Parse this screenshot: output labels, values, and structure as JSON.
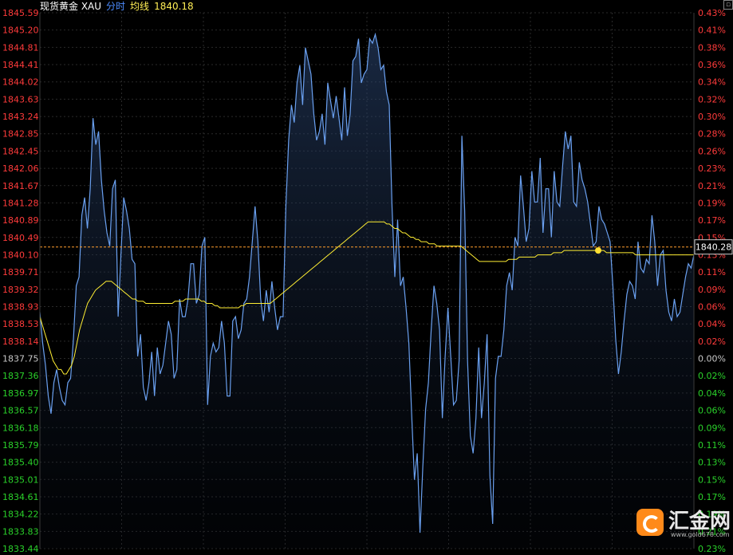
{
  "header": {
    "instrument": "现货黄金 XAU",
    "tab": "分时",
    "avg_label": "均线",
    "price": "1840.18"
  },
  "colors": {
    "up": "#ff3b3b",
    "down": "#2ad12a",
    "neutral": "#c8c8c8",
    "price_line": "#6aa0f0",
    "avg_line": "#ffee33",
    "ref_line": "#ff9d2e"
  },
  "watermark": {
    "text": "汇金网",
    "url": "www.gold678.com"
  },
  "chart_data": {
    "type": "line",
    "ylim": [
      1833.44,
      1845.59
    ],
    "reference_price": 1837.75,
    "last_price_label": "1840.28",
    "last_price": 1840.28,
    "price_ticks": [
      "1845.59",
      "1845.20",
      "1844.81",
      "1844.41",
      "1844.02",
      "1843.63",
      "1843.24",
      "1842.85",
      "1842.45",
      "1842.06",
      "1841.67",
      "1841.28",
      "1840.89",
      "1840.49",
      "1840.10",
      "1839.71",
      "1839.32",
      "1838.93",
      "1838.53",
      "1838.14",
      "1837.75",
      "1837.36",
      "1836.97",
      "1836.57",
      "1836.18",
      "1835.79",
      "1835.40",
      "1835.01",
      "1834.61",
      "1834.22",
      "1833.83",
      "1833.44"
    ],
    "pct_ticks": [
      "0.43%",
      "0.41%",
      "0.38%",
      "0.36%",
      "0.34%",
      "0.32%",
      "0.30%",
      "0.28%",
      "0.26%",
      "0.23%",
      "0.21%",
      "0.19%",
      "0.17%",
      "0.15%",
      "0.13%",
      "0.11%",
      "0.09%",
      "0.06%",
      "0.04%",
      "0.02%",
      "0.00%",
      "0.02%",
      "0.04%",
      "0.06%",
      "0.09%",
      "0.11%",
      "0.13%",
      "0.15%",
      "0.17%",
      "0.19%",
      "0.21%",
      "0.23%"
    ],
    "series": [
      {
        "values": [
          1838.8,
          1838.1,
          1837.6,
          1836.9,
          1836.5,
          1837.2,
          1837.5,
          1837.1,
          1836.8,
          1836.7,
          1837.2,
          1837.3,
          1838.2,
          1839.4,
          1839.6,
          1841.0,
          1841.4,
          1840.7,
          1841.6,
          1843.2,
          1842.6,
          1842.9,
          1841.8,
          1841.1,
          1840.6,
          1840.3,
          1841.6,
          1841.8,
          1838.7,
          1840.1,
          1841.4,
          1841.1,
          1840.7,
          1840.0,
          1839.9,
          1837.8,
          1838.3,
          1837.1,
          1836.8,
          1837.2,
          1837.9,
          1836.9,
          1838.0,
          1837.4,
          1837.6,
          1838.1,
          1838.6,
          1838.3,
          1837.3,
          1837.5,
          1839.1,
          1838.7,
          1838.7,
          1839.1,
          1839.9,
          1839.9,
          1839.0,
          1839.2,
          1840.3,
          1840.5,
          1836.7,
          1837.8,
          1838.1,
          1837.9,
          1838.0,
          1838.6,
          1838.1,
          1836.9,
          1836.9,
          1838.6,
          1838.7,
          1838.2,
          1838.4,
          1839.0,
          1839.1,
          1839.6,
          1840.4,
          1841.2,
          1840.4,
          1839.1,
          1838.6,
          1839.3,
          1838.8,
          1839.5,
          1838.9,
          1838.4,
          1838.7,
          1838.7,
          1841.2,
          1842.7,
          1843.5,
          1843.1,
          1844.0,
          1844.4,
          1843.5,
          1844.8,
          1844.5,
          1844.2,
          1843.3,
          1842.7,
          1842.9,
          1843.3,
          1842.6,
          1844.0,
          1843.6,
          1843.2,
          1843.7,
          1843.2,
          1842.7,
          1843.9,
          1842.8,
          1843.3,
          1844.5,
          1844.6,
          1845.0,
          1844.0,
          1844.2,
          1844.3,
          1845.0,
          1844.9,
          1845.1,
          1844.8,
          1844.3,
          1844.4,
          1843.8,
          1843.5,
          1841.2,
          1839.6,
          1840.9,
          1839.4,
          1839.6,
          1838.9,
          1838.1,
          1836.5,
          1835.0,
          1835.6,
          1833.8,
          1835.3,
          1836.6,
          1837.2,
          1838.4,
          1839.4,
          1839.0,
          1838.4,
          1836.4,
          1837.8,
          1838.9,
          1837.8,
          1836.7,
          1836.8,
          1837.7,
          1842.8,
          1841.1,
          1837.7,
          1836.0,
          1835.6,
          1836.4,
          1838.0,
          1836.4,
          1837.2,
          1838.3,
          1835.1,
          1834.0,
          1837.3,
          1837.8,
          1837.8,
          1838.4,
          1839.4,
          1839.7,
          1839.3,
          1840.5,
          1840.3,
          1841.9,
          1841.2,
          1840.4,
          1840.7,
          1842.0,
          1841.3,
          1841.3,
          1842.3,
          1840.6,
          1841.6,
          1841.6,
          1840.5,
          1842.0,
          1841.3,
          1841.2,
          1842.1,
          1842.9,
          1842.5,
          1842.8,
          1841.3,
          1841.2,
          1842.2,
          1841.8,
          1841.6,
          1841.3,
          1840.8,
          1840.3,
          1840.4,
          1841.2,
          1840.9,
          1840.8,
          1840.6,
          1840.4,
          1839.4,
          1838.2,
          1837.4,
          1837.9,
          1838.6,
          1839.2,
          1839.5,
          1839.4,
          1839.1,
          1840.4,
          1839.8,
          1839.7,
          1840.0,
          1839.9,
          1841.0,
          1840.4,
          1839.4,
          1840.1,
          1840.2,
          1839.3,
          1838.8,
          1838.6,
          1839.1,
          1838.7,
          1838.8,
          1839.2,
          1839.6,
          1839.9,
          1839.8,
          1840.1
        ]
      },
      {
        "values": [
          1838.7,
          1838.5,
          1838.3,
          1838.1,
          1837.9,
          1837.7,
          1837.6,
          1837.5,
          1837.5,
          1837.4,
          1837.4,
          1837.5,
          1837.6,
          1837.8,
          1838.1,
          1838.4,
          1838.6,
          1838.8,
          1839.0,
          1839.1,
          1839.2,
          1839.3,
          1839.35,
          1839.4,
          1839.45,
          1839.5,
          1839.5,
          1839.5,
          1839.45,
          1839.4,
          1839.35,
          1839.3,
          1839.25,
          1839.2,
          1839.15,
          1839.1,
          1839.1,
          1839.05,
          1839.05,
          1839.05,
          1839.0,
          1839.0,
          1839.0,
          1839.0,
          1839.0,
          1839.0,
          1839.0,
          1839.0,
          1839.0,
          1839.0,
          1839.0,
          1839.05,
          1839.05,
          1839.05,
          1839.05,
          1839.1,
          1839.1,
          1839.1,
          1839.1,
          1839.1,
          1839.1,
          1839.05,
          1839.05,
          1839.0,
          1839.0,
          1839.0,
          1838.95,
          1838.95,
          1838.9,
          1838.9,
          1838.9,
          1838.9,
          1838.9,
          1838.9,
          1838.9,
          1838.9,
          1838.95,
          1838.95,
          1839.0,
          1839.0,
          1839.0,
          1839.0,
          1839.0,
          1839.0,
          1839.0,
          1839.0,
          1839.0,
          1839.0,
          1839.05,
          1839.1,
          1839.15,
          1839.2,
          1839.25,
          1839.3,
          1839.35,
          1839.4,
          1839.45,
          1839.5,
          1839.55,
          1839.6,
          1839.65,
          1839.7,
          1839.75,
          1839.8,
          1839.85,
          1839.9,
          1839.95,
          1840.0,
          1840.05,
          1840.1,
          1840.15,
          1840.2,
          1840.25,
          1840.3,
          1840.35,
          1840.4,
          1840.45,
          1840.5,
          1840.55,
          1840.6,
          1840.65,
          1840.7,
          1840.75,
          1840.8,
          1840.85,
          1840.85,
          1840.85,
          1840.85,
          1840.85,
          1840.85,
          1840.85,
          1840.8,
          1840.8,
          1840.75,
          1840.7,
          1840.7,
          1840.65,
          1840.6,
          1840.6,
          1840.55,
          1840.5,
          1840.5,
          1840.45,
          1840.45,
          1840.4,
          1840.4,
          1840.4,
          1840.35,
          1840.35,
          1840.35,
          1840.3,
          1840.3,
          1840.3,
          1840.3,
          1840.3,
          1840.3,
          1840.3,
          1840.3,
          1840.3,
          1840.3,
          1840.25,
          1840.2,
          1840.15,
          1840.1,
          1840.05,
          1840.0,
          1839.95,
          1839.95,
          1839.95,
          1839.95,
          1839.95,
          1839.95,
          1839.95,
          1839.95,
          1839.95,
          1839.95,
          1839.95,
          1840.0,
          1840.0,
          1840.0,
          1840.0,
          1840.05,
          1840.05,
          1840.05,
          1840.05,
          1840.05,
          1840.05,
          1840.05,
          1840.1,
          1840.1,
          1840.1,
          1840.1,
          1840.1,
          1840.1,
          1840.15,
          1840.15,
          1840.15,
          1840.15,
          1840.2,
          1840.2,
          1840.2,
          1840.2,
          1840.2,
          1840.2,
          1840.2,
          1840.2,
          1840.2,
          1840.2,
          1840.2,
          1840.2,
          1840.2,
          1840.2,
          1840.2,
          1840.2,
          1840.15,
          1840.15,
          1840.15,
          1840.15,
          1840.15,
          1840.15,
          1840.15,
          1840.15,
          1840.15,
          1840.15,
          1840.15,
          1840.1,
          1840.1,
          1840.1,
          1840.1,
          1840.1,
          1840.1,
          1840.1,
          1840.1,
          1840.1,
          1840.1,
          1840.1,
          1840.1,
          1840.1,
          1840.1,
          1840.1,
          1840.1,
          1840.1,
          1840.1,
          1840.1,
          1840.1,
          1840.1,
          1840.1,
          1840.1
        ]
      }
    ]
  }
}
